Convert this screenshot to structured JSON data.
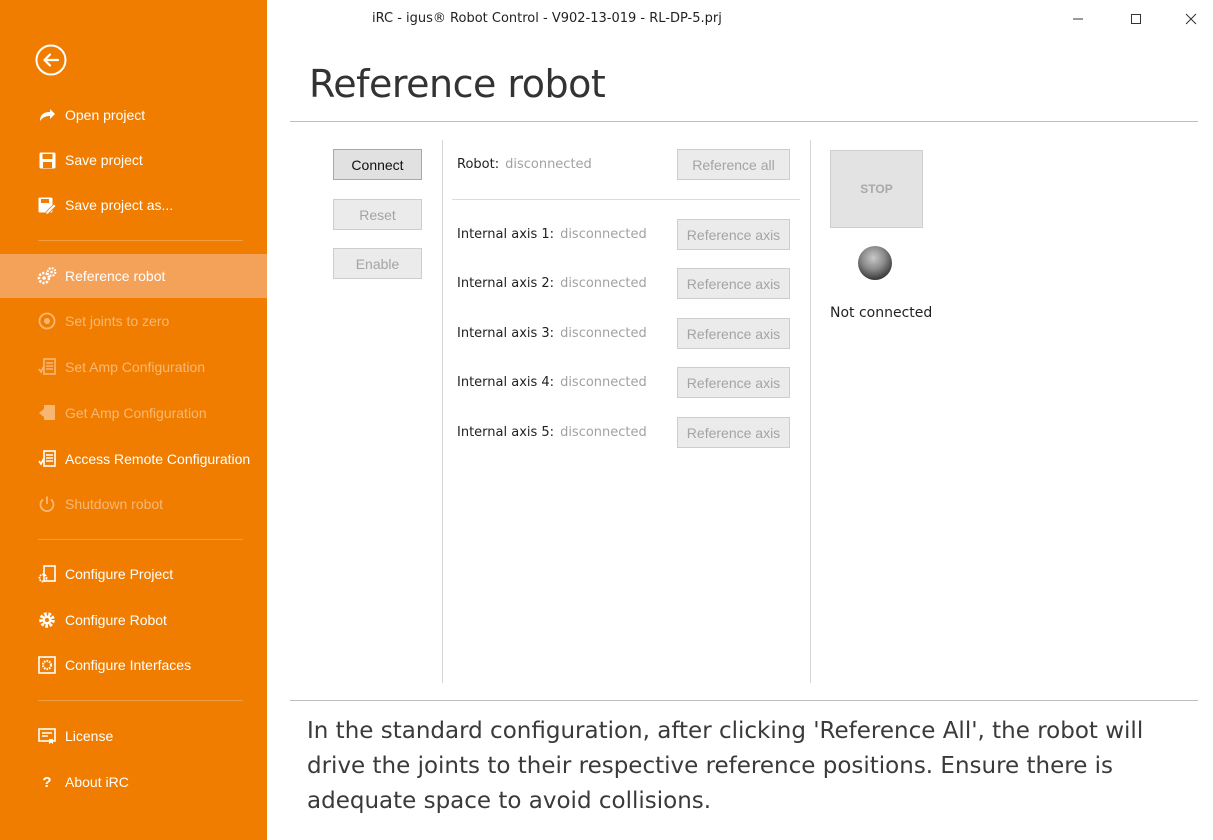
{
  "window": {
    "title": "iRC - igus® Robot Control - V902-13-019 - RL-DP-5.prj",
    "controls": {
      "minimize": "—",
      "maximize": "☐",
      "close": "✕"
    }
  },
  "colors": {
    "sidebar": "#F07D00",
    "active_item": "#F4A259"
  },
  "sidebar": {
    "back_icon": "back-arrow-circle-icon",
    "groups": [
      [
        {
          "label": "Open project",
          "icon": "open-arrow-icon",
          "enabled": true
        },
        {
          "label": "Save project",
          "icon": "save-icon",
          "enabled": true
        },
        {
          "label": "Save project as...",
          "icon": "save-as-icon",
          "enabled": true
        }
      ],
      [
        {
          "label": "Reference robot",
          "icon": "gears-icon",
          "enabled": true,
          "active": true
        },
        {
          "label": "Set joints to zero",
          "icon": "zero-icon",
          "enabled": false
        },
        {
          "label": "Set Amp Configuration",
          "icon": "amp-config-set-icon",
          "enabled": false
        },
        {
          "label": "Get Amp Configuration",
          "icon": "amp-config-get-icon",
          "enabled": false
        },
        {
          "label": "Access Remote Configuration",
          "icon": "remote-config-icon",
          "enabled": true
        },
        {
          "label": "Shutdown robot",
          "icon": "power-icon",
          "enabled": false
        }
      ],
      [
        {
          "label": "Configure Project",
          "icon": "configure-project-icon",
          "enabled": true
        },
        {
          "label": "Configure Robot",
          "icon": "gear-icon",
          "enabled": true
        },
        {
          "label": "Configure Interfaces",
          "icon": "interfaces-icon",
          "enabled": true
        }
      ],
      [
        {
          "label": "License",
          "icon": "license-icon",
          "enabled": true
        },
        {
          "label": "About iRC",
          "icon": "question-icon",
          "enabled": true
        }
      ]
    ]
  },
  "page": {
    "title": "Reference robot",
    "buttons": {
      "connect": "Connect",
      "reset": "Reset",
      "enable": "Enable"
    },
    "robot": {
      "label": "Robot:",
      "status": "disconnected",
      "button": "Reference all"
    },
    "axes": [
      {
        "label": "Internal axis 1:",
        "status": "disconnected",
        "button": "Reference axis"
      },
      {
        "label": "Internal axis 2:",
        "status": "disconnected",
        "button": "Reference axis"
      },
      {
        "label": "Internal axis 3:",
        "status": "disconnected",
        "button": "Reference axis"
      },
      {
        "label": "Internal axis 4:",
        "status": "disconnected",
        "button": "Reference axis"
      },
      {
        "label": "Internal axis 5:",
        "status": "disconnected",
        "button": "Reference axis"
      }
    ],
    "stop": "STOP",
    "connection_status": "Not connected",
    "info": "In the standard configuration, after clicking 'Reference All', the robot will drive the joints to their respective reference positions. Ensure there is adequate space to avoid collisions."
  }
}
